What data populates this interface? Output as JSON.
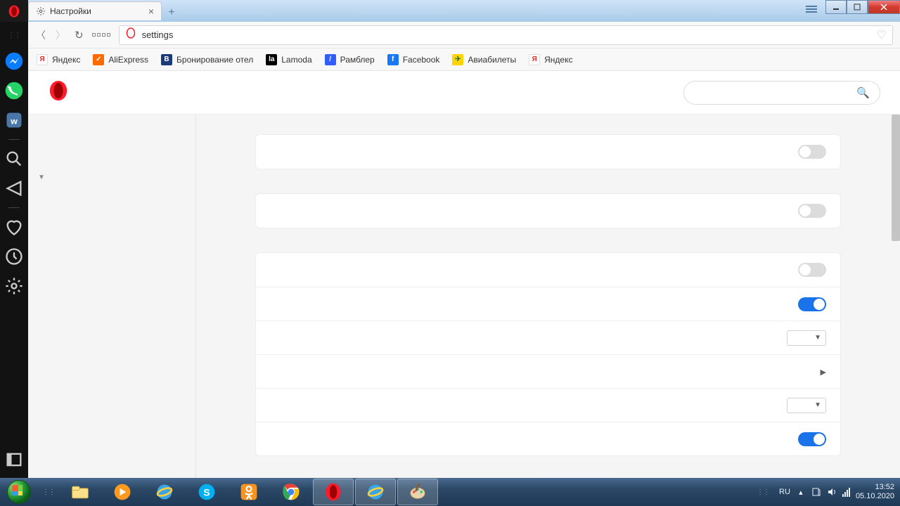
{
  "tab": {
    "title": "Настройки"
  },
  "address": {
    "url": "settings"
  },
  "bookmarks": [
    {
      "label": "Яндекс",
      "bg": "#ffffff",
      "fg": "#e52e2e",
      "char": "Я"
    },
    {
      "label": "AliExpress",
      "bg": "#ff6a00",
      "fg": "#ffffff",
      "char": "✓"
    },
    {
      "label": "Бронирование отел",
      "bg": "#1a3b7a",
      "fg": "#ffffff",
      "char": "B"
    },
    {
      "label": "Lamoda",
      "bg": "#000000",
      "fg": "#ffffff",
      "char": "la"
    },
    {
      "label": "Рамблер",
      "bg": "#315efb",
      "fg": "#ffffff",
      "char": "/"
    },
    {
      "label": "Facebook",
      "bg": "#1877f2",
      "fg": "#ffffff",
      "char": "f"
    },
    {
      "label": "Авиабилеты",
      "bg": "#ffd400",
      "fg": "#2a6f3a",
      "char": "✈"
    },
    {
      "label": "Яндекс",
      "bg": "#ffffff",
      "fg": "#e52e2e",
      "char": "Я"
    }
  ],
  "settings_rows": [
    {
      "type": "toggle",
      "on": false
    },
    {
      "type": "spacer"
    },
    {
      "type": "toggle",
      "on": false
    },
    {
      "type": "spacer"
    },
    {
      "type": "toggle",
      "on": false
    },
    {
      "type": "toggle",
      "on": true
    },
    {
      "type": "select"
    },
    {
      "type": "chevron"
    },
    {
      "type": "select"
    },
    {
      "type": "toggle",
      "on": true
    }
  ],
  "tray": {
    "lang": "RU",
    "time": "13:52",
    "date": "05.10.2020"
  }
}
